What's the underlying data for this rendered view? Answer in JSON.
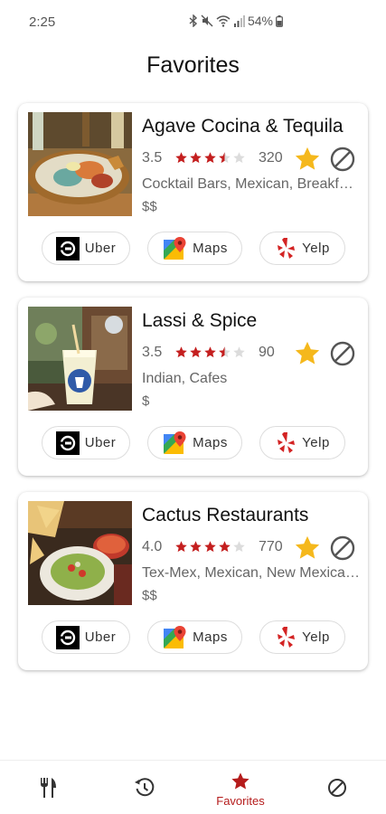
{
  "status": {
    "time": "2:25",
    "battery": "54%"
  },
  "page_title": "Favorites",
  "colors": {
    "star_red": "#c41f1f",
    "star_empty": "#dcdcdc",
    "favorite_gold": "#f5b81c",
    "nav_active": "#b51c1c",
    "nav_inactive": "#333333"
  },
  "restaurants": [
    {
      "name": "Agave Cocina & Tequila",
      "rating": "3.5",
      "rating_value": 3.5,
      "review_count": "320",
      "categories": "Cocktail Bars, Mexican, Breakfast & Brunch",
      "price": "$$",
      "favorited": true,
      "photo_icon": "mexican-dish-photo"
    },
    {
      "name": "Lassi & Spice",
      "rating": "3.5",
      "rating_value": 3.5,
      "review_count": "90",
      "categories": "Indian, Cafes",
      "price": "$",
      "favorited": true,
      "photo_icon": "lassi-drink-photo"
    },
    {
      "name": "Cactus Restaurants",
      "rating": "4.0",
      "rating_value": 4.0,
      "review_count": "770",
      "categories": "Tex-Mex, Mexican, New Mexican Cuisine",
      "price": "$$",
      "favorited": true,
      "photo_icon": "guacamole-chips-photo"
    }
  ],
  "actions": {
    "uber": "Uber",
    "maps": "Maps",
    "yelp": "Yelp"
  },
  "bottom_nav": {
    "items": [
      {
        "icon": "fork-knife-icon",
        "label": ""
      },
      {
        "icon": "history-icon",
        "label": ""
      },
      {
        "icon": "star-icon",
        "label": "Favorites",
        "active": true
      },
      {
        "icon": "block-icon",
        "label": ""
      }
    ]
  }
}
